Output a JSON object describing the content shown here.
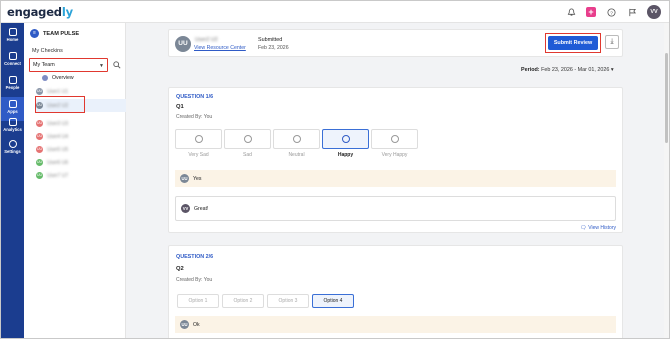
{
  "app": {
    "logo_main": "engaged",
    "logo_accent": "ly"
  },
  "topbar": {
    "icons": [
      "bell-icon",
      "plus-icon",
      "help-icon",
      "flag-icon"
    ],
    "user_initials": "VV"
  },
  "leftnav": [
    {
      "label": "Home",
      "icon": "home-icon"
    },
    {
      "label": "Connect",
      "icon": "chat-icon"
    },
    {
      "label": "People",
      "icon": "people-icon"
    },
    {
      "label": "Apps",
      "icon": "apps-icon",
      "active": true
    },
    {
      "label": "Analytics",
      "icon": "analytics-icon"
    },
    {
      "label": "Settings",
      "icon": "gear-icon"
    }
  ],
  "sidebar": {
    "title": "TEAM PULSE",
    "my_checkins": "My Checkins",
    "team_select": "My Team",
    "overview": "Overview",
    "users": [
      {
        "initials": "UU",
        "name": "User1 U1",
        "color": "#8a96a8"
      },
      {
        "initials": "UU",
        "name": "User2 U2",
        "color": "#7b8796",
        "selected": true
      },
      {
        "initials": "UU",
        "name": "User3 U3",
        "color": "#e57373"
      },
      {
        "initials": "UU",
        "name": "User4 U4",
        "color": "#e57373"
      },
      {
        "initials": "UU",
        "name": "User5 U5",
        "color": "#e57373"
      },
      {
        "initials": "UU",
        "name": "User6 U6",
        "color": "#66bb6a"
      },
      {
        "initials": "UU",
        "name": "User7 U7",
        "color": "#66bb6a"
      }
    ]
  },
  "header": {
    "initials": "UU",
    "name": "User2 U2",
    "link": "View Resource Center",
    "status": "Submitted",
    "date": "Feb 23, 2026",
    "submit_label": "Submit Review"
  },
  "period": {
    "label": "Period:",
    "value": "Feb 23, 2026 - Mar 01, 2026"
  },
  "q1": {
    "label": "QUESTION 1/6",
    "name": "Q1",
    "created": "Created By: You",
    "moods": [
      "Very Sad",
      "Sad",
      "Neutral",
      "Happy",
      "Very Happy"
    ],
    "selected_mood": "Happy",
    "answer_initials": "UU",
    "answer": "Yes",
    "comment_initials": "VV",
    "comment": "Great!",
    "view_history": "View History"
  },
  "q2": {
    "label": "QUESTION 2/6",
    "name": "Q2",
    "created": "Created By: You",
    "options": [
      "Option 1",
      "Option 2",
      "Option 3",
      "Option 4"
    ],
    "selected_option": "Option 4",
    "answer_initials": "UU",
    "answer": "Ok"
  }
}
